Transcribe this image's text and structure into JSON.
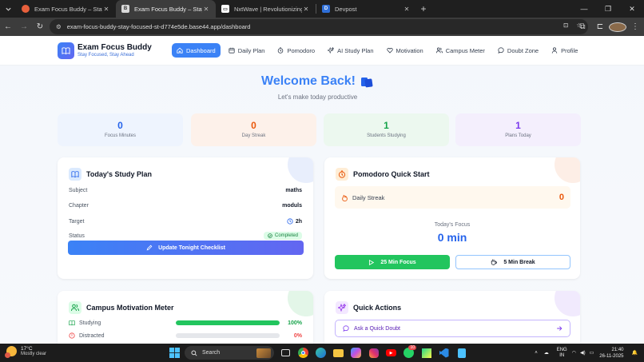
{
  "browser": {
    "tabs": [
      {
        "title": "Exam Focus Buddy – Stay Focu",
        "fav_color": "#e8603c",
        "active": false
      },
      {
        "title": "Exam Focus Buddy – Stay Focu",
        "fav_color": "#d9d9d9",
        "active": true
      },
      {
        "title": "NxtWave | Revolutionizing the",
        "fav_color": "#ffffff",
        "active": false
      },
      {
        "title": "Devpost",
        "fav_color": "#2f6fd8",
        "active": false
      }
    ],
    "url": "exam-focus-buddy-stay-focused-st-d774e5de.base44.app/dashboard"
  },
  "app": {
    "name": "Exam Focus Buddy",
    "tagline": "Stay Focused, Stay Ahead",
    "nav": [
      {
        "label": "Dashboard",
        "icon": "home-icon",
        "active": true
      },
      {
        "label": "Daily Plan",
        "icon": "calendar-icon"
      },
      {
        "label": "Pomodoro",
        "icon": "timer-icon"
      },
      {
        "label": "AI Study Plan",
        "icon": "sparkles-icon"
      },
      {
        "label": "Motivation",
        "icon": "heart-icon"
      },
      {
        "label": "Campus Meter",
        "icon": "users-icon"
      },
      {
        "label": "Doubt Zone",
        "icon": "chat-icon"
      },
      {
        "label": "Profile",
        "icon": "user-icon"
      }
    ]
  },
  "welcome": {
    "title": "Welcome Back!",
    "subtitle": "Let's make today productive"
  },
  "stats": [
    {
      "value": "0",
      "label": "Focus Minutes",
      "color": "#2563eb",
      "bg": "#eef4fe"
    },
    {
      "value": "0",
      "label": "Day Streak",
      "color": "#ea580c",
      "bg": "#fdf1ea"
    },
    {
      "value": "1",
      "label": "Students Studying",
      "color": "#16a34a",
      "bg": "#ecf8ef"
    },
    {
      "value": "1",
      "label": "Plans Today",
      "color": "#7c3aed",
      "bg": "#f4effd"
    }
  ],
  "study_plan": {
    "title": "Today's Study Plan",
    "rows": [
      {
        "key": "Subject",
        "value": "maths"
      },
      {
        "key": "Chapter",
        "value": "moduls"
      },
      {
        "key": "Target",
        "value": "2h"
      }
    ],
    "status_key": "Status",
    "status_value": "Completed",
    "button": "Update Tonight Checklist"
  },
  "pomodoro": {
    "title": "Pomodoro Quick Start",
    "streak_label": "Daily Streak",
    "streak_value": "0",
    "focus_label": "Today's Focus",
    "focus_value": "0 min",
    "focus_button": "25 Min Focus",
    "break_button": "5 Min Break"
  },
  "campus": {
    "title": "Campus Motivation Meter",
    "rows": [
      {
        "label": "Studying",
        "percent": "100%",
        "fraction": 1.0,
        "color": "#22c55e"
      },
      {
        "label": "Distracted",
        "percent": "0%",
        "fraction": 0.0,
        "color": "#ef4444"
      }
    ]
  },
  "quick_actions": {
    "title": "Quick Actions",
    "items": [
      {
        "label": "Ask a Quick Doubt"
      }
    ]
  },
  "taskbar": {
    "temp": "17°C",
    "weather": "Mostly clear",
    "search": "Search",
    "lang1": "ENG",
    "lang2": "IN",
    "time": "21:40",
    "date": "26-11-2025",
    "whatsapp_badge": "10"
  }
}
